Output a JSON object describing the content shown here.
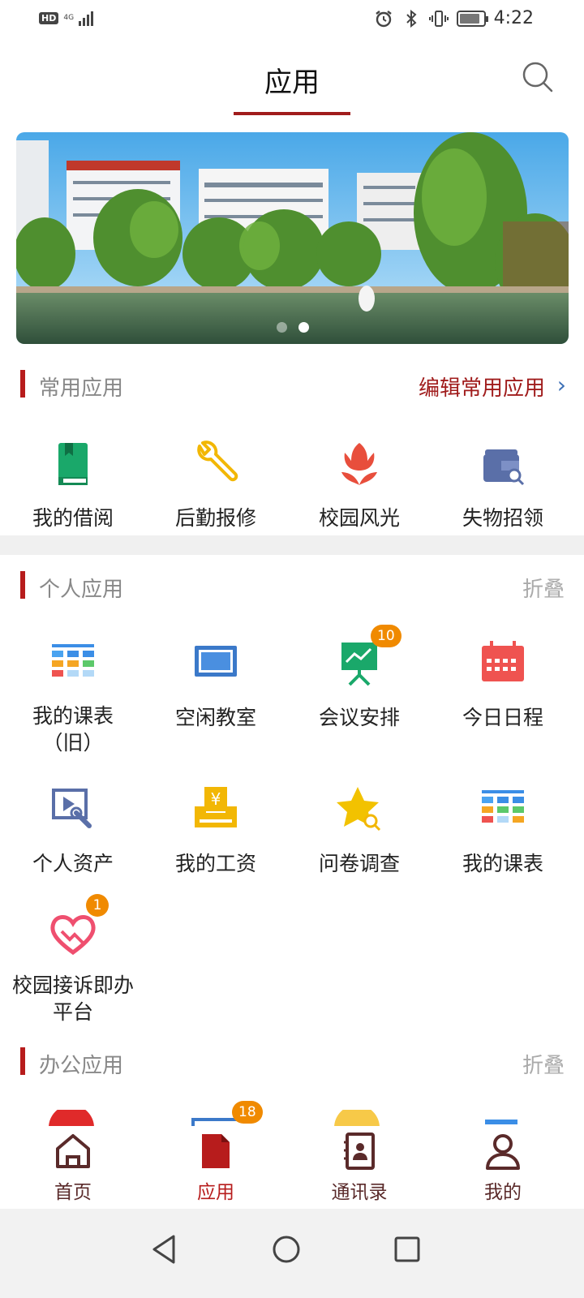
{
  "status_bar": {
    "hd": "HD",
    "network": "4G",
    "time": "4:22"
  },
  "header": {
    "title": "应用",
    "search_icon": "search-icon"
  },
  "banner": {
    "slides": 2,
    "active_slide": 2
  },
  "common_apps": {
    "title": "常用应用",
    "action": "编辑常用应用",
    "items": [
      {
        "label": "我的借阅",
        "icon": "book-icon",
        "color": "#1aa86a"
      },
      {
        "label": "后勤报修",
        "icon": "wrench-icon",
        "color": "#f2b705"
      },
      {
        "label": "校园风光",
        "icon": "tulip-icon",
        "color": "#e84e3c"
      },
      {
        "label": "失物招领",
        "icon": "wallet-search-icon",
        "color": "#5a6fa8"
      }
    ]
  },
  "personal_apps": {
    "title": "个人应用",
    "action": "折叠",
    "items": [
      {
        "label": "我的课表（旧）",
        "icon": "timetable-icon",
        "badge": ""
      },
      {
        "label": "空闲教室",
        "icon": "classroom-screen-icon",
        "badge": ""
      },
      {
        "label": "会议安排",
        "icon": "meeting-board-icon",
        "badge": "10"
      },
      {
        "label": "今日日程",
        "icon": "calendar-icon",
        "badge": ""
      },
      {
        "label": "个人资产",
        "icon": "asset-tool-icon",
        "badge": ""
      },
      {
        "label": "我的工资",
        "icon": "salary-icon",
        "badge": ""
      },
      {
        "label": "问卷调查",
        "icon": "star-search-icon",
        "badge": ""
      },
      {
        "label": "我的课表",
        "icon": "timetable-icon",
        "badge": ""
      },
      {
        "label": "校园接诉即办平台",
        "icon": "heart-handshake-icon",
        "badge": "1"
      }
    ]
  },
  "office_apps": {
    "title": "办公应用",
    "action": "折叠",
    "badge": "18"
  },
  "tabbar": {
    "items": [
      {
        "label": "首页",
        "icon": "home-icon"
      },
      {
        "label": "应用",
        "icon": "document-icon"
      },
      {
        "label": "通讯录",
        "icon": "contacts-book-icon"
      },
      {
        "label": "我的",
        "icon": "person-icon"
      }
    ],
    "active": 1
  },
  "colors": {
    "brand_red": "#a01c1c",
    "badge_orange": "#f08a00"
  }
}
